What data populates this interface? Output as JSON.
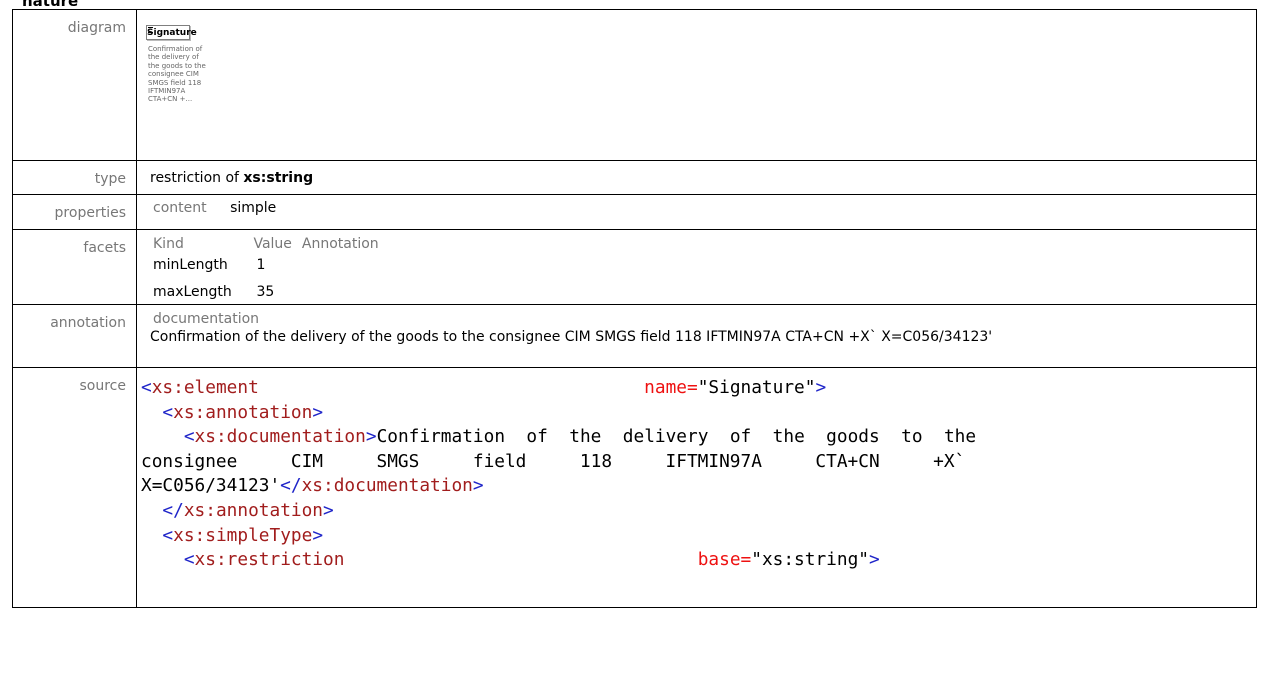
{
  "heading": "nature",
  "labels": {
    "diagram": "diagram",
    "type": "type",
    "properties": "properties",
    "facets": "facets",
    "annotation": "annotation",
    "source": "source"
  },
  "diagram": {
    "element_name": "Signature",
    "documentation": "Confirmation of the delivery of the goods to the consignee CIM SMGS field 118 IFTMIN97A CTA+CN +..."
  },
  "type": {
    "prefix": "restriction of",
    "base": "xs:string"
  },
  "properties": {
    "key": "content",
    "value": "simple"
  },
  "facets": {
    "headers": [
      "Kind",
      "Value",
      "Annotation"
    ],
    "rows": [
      {
        "kind": "minLength",
        "value": "1"
      },
      {
        "kind": "maxLength",
        "value": "35"
      }
    ]
  },
  "annotation": {
    "key": "documentation",
    "text": "Confirmation of the delivery of the goods to the consignee CIM SMGS field 118 IFTMIN97A CTA+CN +X` X=C056/34123'"
  },
  "source": {
    "line1_tag": "xs:element",
    "line1_attr": "name=",
    "line1_val": "\"Signature\"",
    "annotation_tag": "xs:annotation",
    "documentation_tag": "xs:documentation",
    "doc_text_1": "Confirmation  of  the  delivery  of  the  goods  to  the",
    "doc_text_2": "consignee     CIM     SMGS     field     118     IFTMIN97A     CTA+CN     +X`",
    "doc_text_3": "X=C056/34123'",
    "simpletype_tag": "xs:simpleType",
    "restriction_tag": "xs:restriction",
    "restriction_attr": "base=",
    "restriction_val": "\"xs:string\""
  }
}
